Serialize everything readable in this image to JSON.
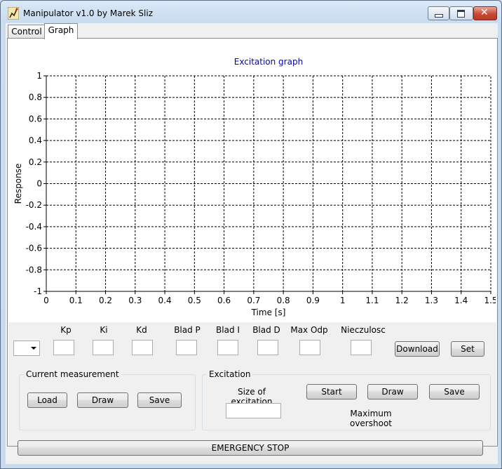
{
  "window": {
    "title": "Manipulator v1.0 by Marek Sliz"
  },
  "tabs": [
    {
      "label": "Control",
      "active": false
    },
    {
      "label": "Graph",
      "active": true
    }
  ],
  "chart_data": {
    "type": "line",
    "title": "Excitation graph",
    "xlabel": "Time [s]",
    "ylabel": "Response",
    "xlim": [
      0,
      1.5
    ],
    "ylim": [
      -1,
      1
    ],
    "xticks": [
      "0",
      "0.1",
      "0.2",
      "0.3",
      "0.4",
      "0.5",
      "0.6",
      "0.7",
      "0.8",
      "0.9",
      "1",
      "1.1",
      "1.2",
      "1.3",
      "1.4",
      "1.5"
    ],
    "yticks": [
      "1",
      "0.8",
      "0.6",
      "0.4",
      "0.2",
      "0",
      "-0.2",
      "-0.4",
      "-0.6",
      "-0.8",
      "-1"
    ],
    "grid": true,
    "series": [],
    "colors": {
      "title": "#0000cc",
      "grid": "#000000"
    }
  },
  "params": {
    "labels": [
      "Kp",
      "Ki",
      "Kd",
      "Blad P",
      "Blad I",
      "Blad D",
      "Max Odp",
      "Nieczulosc"
    ],
    "download_label": "Download",
    "set_label": "Set"
  },
  "current_measurement": {
    "title": "Current measurement",
    "load_label": "Load",
    "draw_label": "Draw",
    "save_label": "Save"
  },
  "excitation": {
    "title": "Excitation",
    "size_label": "Size of excitation",
    "start_label": "Start",
    "draw_label": "Draw",
    "save_label": "Save",
    "overshoot_label": "Maximum overshoot"
  },
  "emergency_label": "EMERGENCY STOP"
}
